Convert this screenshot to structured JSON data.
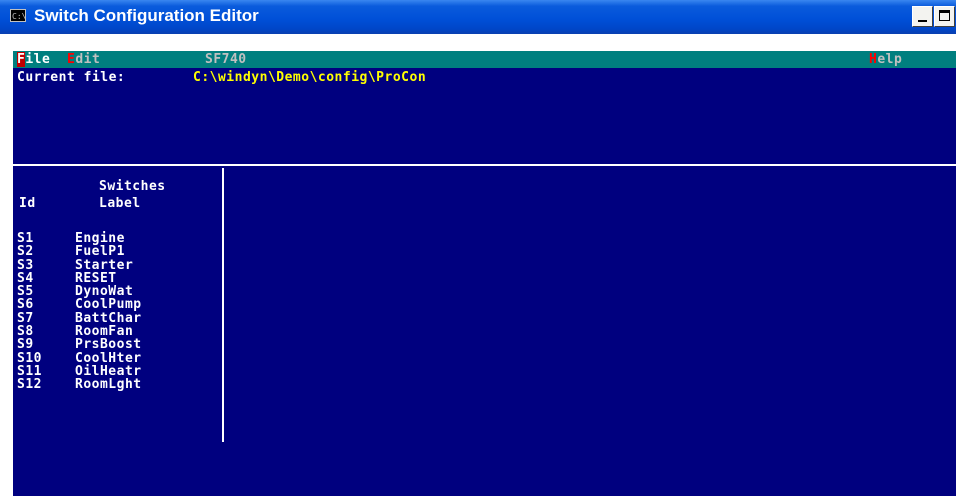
{
  "window": {
    "title": "Switch Configuration Editor",
    "icon_text": "C:\\"
  },
  "menu": {
    "file": {
      "hot": "F",
      "rest": "ile"
    },
    "edit": {
      "hot": "E",
      "rest": "dit"
    },
    "device": "SF740",
    "help": {
      "hot": "H",
      "rest": "elp"
    }
  },
  "current_file": {
    "label": "Current file:",
    "path": "C:\\windyn\\Demo\\config\\ProCon"
  },
  "switches": {
    "title": "Switches",
    "col_id": "Id",
    "col_label": "Label",
    "rows": [
      {
        "id": "S1",
        "label": "Engine"
      },
      {
        "id": "S2",
        "label": "FuelP1"
      },
      {
        "id": "S3",
        "label": "Starter"
      },
      {
        "id": "S4",
        "label": "RESET"
      },
      {
        "id": "S5",
        "label": "DynoWat"
      },
      {
        "id": "S6",
        "label": "CoolPump"
      },
      {
        "id": "S7",
        "label": "BattChar"
      },
      {
        "id": "S8",
        "label": "RoomFan"
      },
      {
        "id": "S9",
        "label": "PrsBoost"
      },
      {
        "id": "S10",
        "label": "CoolHter"
      },
      {
        "id": "S11",
        "label": "OilHeatr"
      },
      {
        "id": "S12",
        "label": "RoomLght"
      }
    ]
  },
  "colors": {
    "console_bg": "#00007f",
    "menubar_bg": "#007f7f",
    "path_text": "#ffff00",
    "hotkey": "#ff0000"
  }
}
